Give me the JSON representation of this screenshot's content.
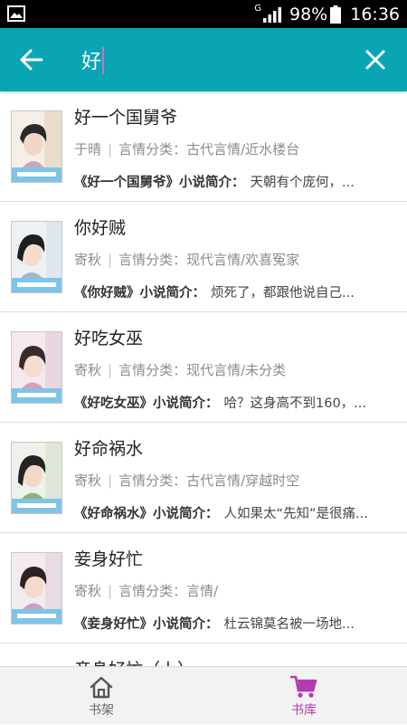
{
  "status_bar": {
    "network": "G",
    "battery": "98%",
    "time": "16:36",
    "icons": [
      "photo-icon",
      "signal-icon",
      "battery-icon"
    ]
  },
  "search": {
    "query": "好",
    "icons": [
      "back-arrow-icon",
      "close-icon"
    ],
    "caret_color": "#d070c8"
  },
  "colors": {
    "header": "#0aa5b5",
    "active_tab": "#b23bb0"
  },
  "results": [
    {
      "title": "好一个国舅爷",
      "author": "于晴",
      "category": "言情分类：古代言情/近水楼台",
      "intro_label": "《好一个国舅爷》小说简介：",
      "intro": "天朝有个庞何，..."
    },
    {
      "title": "你好贼",
      "author": "寄秋",
      "category": "言情分类：现代言情/欢喜冤家",
      "intro_label": "《你好贼》小说简介：",
      "intro": "烦死了，都跟他说自己..."
    },
    {
      "title": "好吃女巫",
      "author": "寄秋",
      "category": "言情分类：现代言情/未分类",
      "intro_label": "《好吃女巫》小说简介：",
      "intro": "哈？这身高不到160，..."
    },
    {
      "title": "好命祸水",
      "author": "寄秋",
      "category": "言情分类：古代言情/穿越时空",
      "intro_label": "《好命祸水》小说简介：",
      "intro": "人如果太“先知”是很痛..."
    },
    {
      "title": "妾身好忙",
      "author": "寄秋",
      "category": "言情分类：言情/",
      "intro_label": "《妾身好忙》小说简介：",
      "intro": "杜云锦莫名被一场地..."
    },
    {
      "title": "妾身好忙（上）",
      "author": "",
      "category": "",
      "intro_label": "",
      "intro": ""
    }
  ],
  "bottom_nav": {
    "shelf_label": "书架",
    "library_label": "书库",
    "icons": [
      "home-icon",
      "cart-icon"
    ]
  }
}
